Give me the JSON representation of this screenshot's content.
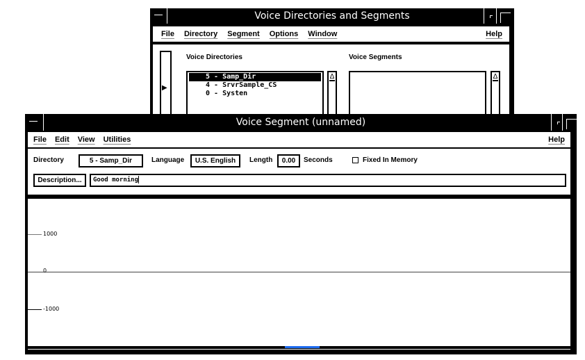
{
  "back_window": {
    "title": "Voice Directories and Segments",
    "menu": [
      "File",
      "Directory",
      "Segment",
      "Options",
      "Window"
    ],
    "help": "Help",
    "directories_label": "Voice Directories",
    "segments_label": "Voice Segments",
    "directories": [
      {
        "label": "5 - Samp_Dir",
        "selected": true
      },
      {
        "label": "4 - SrvrSample_CS",
        "selected": false
      },
      {
        "label": "0 - Systen",
        "selected": false
      }
    ],
    "segments": [],
    "scroll_up_glyph": "Δ",
    "arrow_glyph": "▶"
  },
  "front_window": {
    "title": "Voice Segment (unnamed)",
    "menu": [
      "File",
      "Edit",
      "View",
      "Utilities"
    ],
    "help": "Help",
    "directory_label": "Directory",
    "directory_value": "5 - Samp_Dir",
    "language_label": "Language",
    "language_value": "U.S. English",
    "length_label": "Length",
    "length_value": "0.00",
    "seconds_label": "Seconds",
    "fixed_in_memory_label": "Fixed In Memory",
    "fixed_in_memory_checked": false,
    "description_button": "Description...",
    "description_value": "Good morning",
    "waveform": {
      "tick_labels": [
        "1000",
        "0",
        "-1000"
      ],
      "scroll_accent": "#1e6cf0"
    }
  }
}
